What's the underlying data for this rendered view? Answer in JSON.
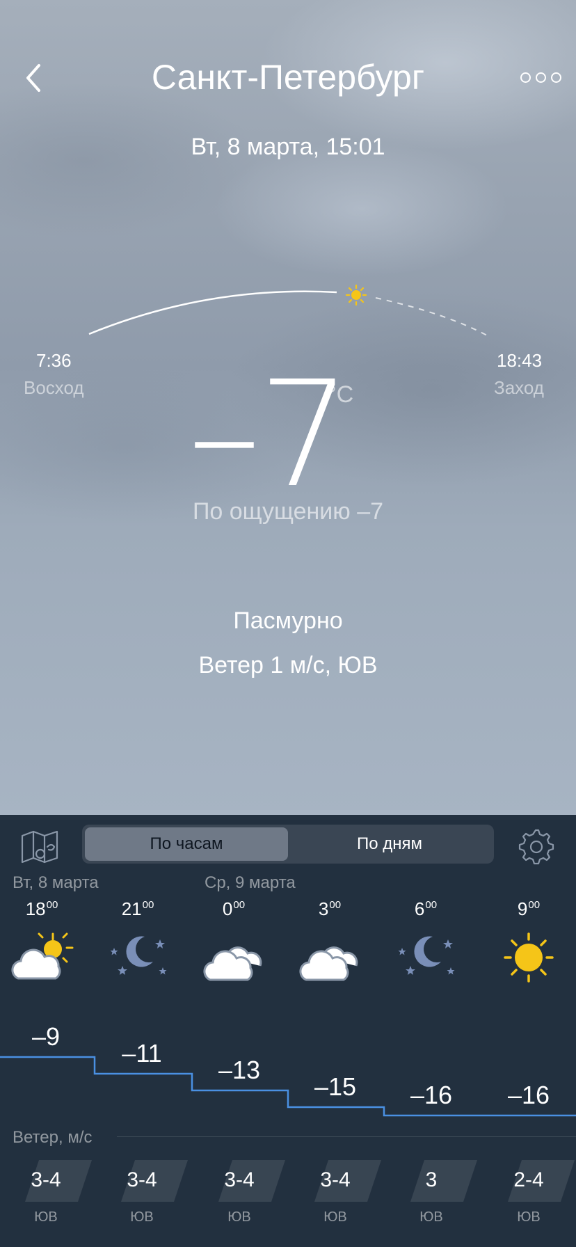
{
  "header": {
    "city": "Санкт-Петербург",
    "datetime": "Вт, 8 марта, 15:01"
  },
  "sun": {
    "sunrise_time": "7:36",
    "sunrise_label": "Восход",
    "sunset_time": "18:43",
    "sunset_label": "Заход"
  },
  "current": {
    "temperature": "–7",
    "unit": "°C",
    "feels_like": "По ощущению –7",
    "condition": "Пасмурно",
    "wind": "Ветер 1 м/с, ЮВ"
  },
  "tabs": {
    "hourly": "По часам",
    "daily": "По дням"
  },
  "days": {
    "day1": "Вт, 8 марта",
    "day2": "Ср, 9 марта"
  },
  "hourly": [
    {
      "hour": "18",
      "minutes": "00",
      "icon": "cloudy-sun-icon",
      "temp": "–9",
      "wind_speed": "3-4",
      "wind_dir": "ЮВ"
    },
    {
      "hour": "21",
      "minutes": "00",
      "icon": "moon-stars-icon",
      "temp": "–11",
      "wind_speed": "3-4",
      "wind_dir": "ЮВ"
    },
    {
      "hour": "0",
      "minutes": "00",
      "icon": "cloud-icon",
      "temp": "–13",
      "wind_speed": "3-4",
      "wind_dir": "ЮВ"
    },
    {
      "hour": "3",
      "minutes": "00",
      "icon": "cloud-icon",
      "temp": "–15",
      "wind_speed": "3-4",
      "wind_dir": "ЮВ"
    },
    {
      "hour": "6",
      "minutes": "00",
      "icon": "moon-stars-icon",
      "temp": "–16",
      "wind_speed": "3",
      "wind_dir": "ЮВ"
    },
    {
      "hour": "9",
      "minutes": "00",
      "icon": "sun-icon",
      "temp": "–16",
      "wind_speed": "2-4",
      "wind_dir": "ЮВ"
    }
  ],
  "wind_section": {
    "title": "Ветер, м/с"
  },
  "colors": {
    "panel_bg": "#22303f",
    "graph_line": "#4a90e2",
    "sun_yellow": "#f5c518",
    "moon_blue": "#7a8fb8"
  }
}
